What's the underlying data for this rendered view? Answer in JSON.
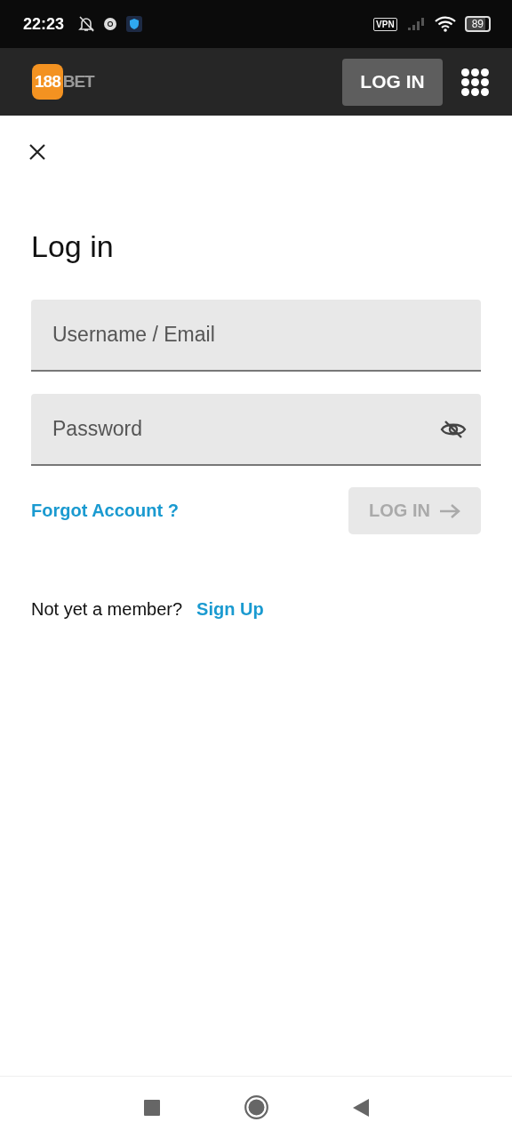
{
  "status_bar": {
    "time": "22:23",
    "vpn": "VPN",
    "battery": "89"
  },
  "header": {
    "logo": {
      "number": "188",
      "word": "BET"
    },
    "login_button": "LOG IN"
  },
  "form": {
    "title": "Log in",
    "fields": [
      {
        "placeholder": "Username / Email",
        "kind": "text"
      },
      {
        "placeholder": "Password",
        "kind": "password"
      }
    ],
    "forgot_link": "Forgot Account ?",
    "submit": {
      "label": "LOG IN",
      "disabled": true
    }
  },
  "signup": {
    "prompt": "Not yet a member?",
    "link": "Sign Up"
  }
}
